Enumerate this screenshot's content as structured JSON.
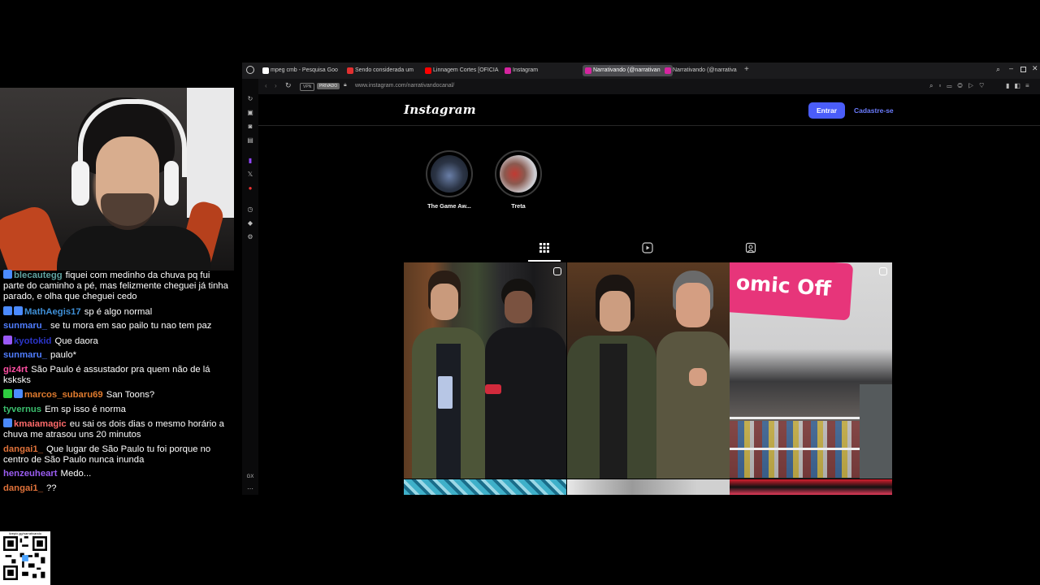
{
  "chat": {
    "messages": [
      {
        "user": "blecautegg",
        "color": "#5fa2a0",
        "badges": [
          "#4b8bff"
        ],
        "text": "fiquei com medinho da chuva pq fui parte do caminho a pé, mas felizmente cheguei já tinha parado, e olha que cheguei cedo"
      },
      {
        "user": "MathAegis17",
        "color": "#3f8fd6",
        "badges": [
          "#4b8bff",
          "#4b8bff"
        ],
        "text": "sp é algo normal"
      },
      {
        "user": "sunmaru_",
        "color": "#4f7dff",
        "badges": [],
        "text": "se tu mora em sao pailo tu nao tem paz"
      },
      {
        "user": "kyotokid",
        "color": "#2b35c9",
        "badges": [
          "#9b59f7"
        ],
        "text": "Que daora"
      },
      {
        "user": "sunmaru_",
        "color": "#4f7dff",
        "badges": [],
        "text": "paulo*"
      },
      {
        "user": "giz4rt",
        "color": "#ff4fa3",
        "badges": [],
        "text": "São Paulo é assustador pra quem não de lá ksksks"
      },
      {
        "user": "marcos_subaru69",
        "color": "#e07b2e",
        "badges": [
          "#2ecc40",
          "#4b8bff"
        ],
        "text": "San Toons?"
      },
      {
        "user": "tyvernus",
        "color": "#3bbf6e",
        "badges": [],
        "text": "Em sp isso é norma"
      },
      {
        "user": "kmaiamagic",
        "color": "#ff6a6a",
        "badges": [
          "#4b8bff"
        ],
        "text": "eu sai os dois dias o mesmo horário a chuva me atrasou uns 20 minutos"
      },
      {
        "user": "dangai1_",
        "color": "#e0723a",
        "badges": [],
        "text": "Que lugar de São Paulo tu foi porque no centro de São Paulo nunca inunda"
      },
      {
        "user": "henzeuheart",
        "color": "#9a5cf0",
        "badges": [],
        "text": "Medo..."
      },
      {
        "user": "dangai1_",
        "color": "#e0723a",
        "badges": [],
        "text": "??"
      }
    ]
  },
  "qr": {
    "caption": "livepix.gg/narrativando"
  },
  "browser": {
    "tabs": [
      {
        "label": "mpeg cmb - Pesquisa Goo",
        "fav": "#ffffff",
        "active": false
      },
      {
        "label": "Sendo considerada um",
        "fav": "#e23030",
        "active": false
      },
      {
        "label": "Linnagem Cortes [OFICIA",
        "fav": "#ff0000",
        "active": false
      },
      {
        "label": "Instagram",
        "fav": "#d6249f",
        "active": false
      },
      {
        "label": "Narrativando (@narrativan",
        "fav": "#d6249f",
        "active": true
      },
      {
        "label": "Narrativando (@narrativa",
        "fav": "#d6249f",
        "active": false
      }
    ],
    "url": "www.instagram.com/narrativandocanal/",
    "vpn_label": "VPN",
    "private_label": "PRIVADO"
  },
  "instagram": {
    "logo": "Instagram",
    "login_label": "Entrar",
    "signup_label": "Cadastre-se",
    "highlights": [
      {
        "label": "The Game Aw..."
      },
      {
        "label": "Treta"
      }
    ],
    "posts": [
      {
        "type": "reel"
      },
      {
        "type": "photo"
      },
      {
        "type": "reel",
        "sign_text": "omic Off"
      }
    ]
  }
}
